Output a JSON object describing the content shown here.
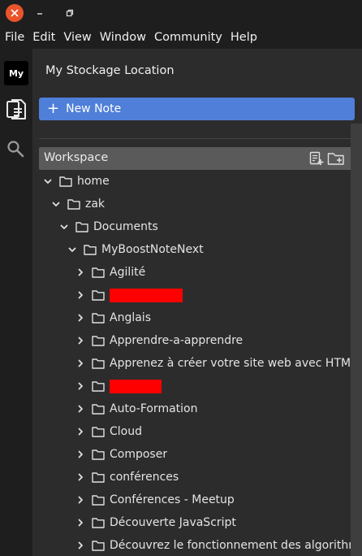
{
  "menus": [
    "File",
    "Edit",
    "View",
    "Window",
    "Community",
    "Help"
  ],
  "storage": {
    "avatar_label": "My",
    "title": "My Stockage Location"
  },
  "sidebar": {
    "new_note_label": "New Note",
    "workspace_label": "Workspace"
  },
  "tree": [
    {
      "label": "home",
      "depth": 0,
      "expanded": true
    },
    {
      "label": "zak",
      "depth": 1,
      "expanded": true
    },
    {
      "label": "Documents",
      "depth": 2,
      "expanded": true
    },
    {
      "label": "MyBoostNoteNext",
      "depth": 3,
      "expanded": true
    },
    {
      "label": "Agilité",
      "depth": 4,
      "expanded": false
    },
    {
      "label": "",
      "depth": 4,
      "expanded": false,
      "redacted": "wide"
    },
    {
      "label": "Anglais",
      "depth": 4,
      "expanded": false
    },
    {
      "label": "Apprendre-a-apprendre",
      "depth": 4,
      "expanded": false
    },
    {
      "label": "Apprenez à créer votre site web avec HTML…",
      "depth": 4,
      "expanded": false
    },
    {
      "label": "",
      "depth": 4,
      "expanded": false,
      "redacted": "narrow"
    },
    {
      "label": "Auto-Formation",
      "depth": 4,
      "expanded": false
    },
    {
      "label": "Cloud",
      "depth": 4,
      "expanded": false
    },
    {
      "label": "Composer",
      "depth": 4,
      "expanded": false
    },
    {
      "label": "conférences",
      "depth": 4,
      "expanded": false
    },
    {
      "label": "Conférences - Meetup",
      "depth": 4,
      "expanded": false
    },
    {
      "label": "Découverte JavaScript",
      "depth": 4,
      "expanded": false
    },
    {
      "label": "Découvrez le fonctionnement des algorithmes",
      "depth": 4,
      "expanded": false
    }
  ],
  "colors": {
    "accent": "#4f7fd8",
    "close": "#e9542b",
    "redaction": "#ff0000"
  }
}
